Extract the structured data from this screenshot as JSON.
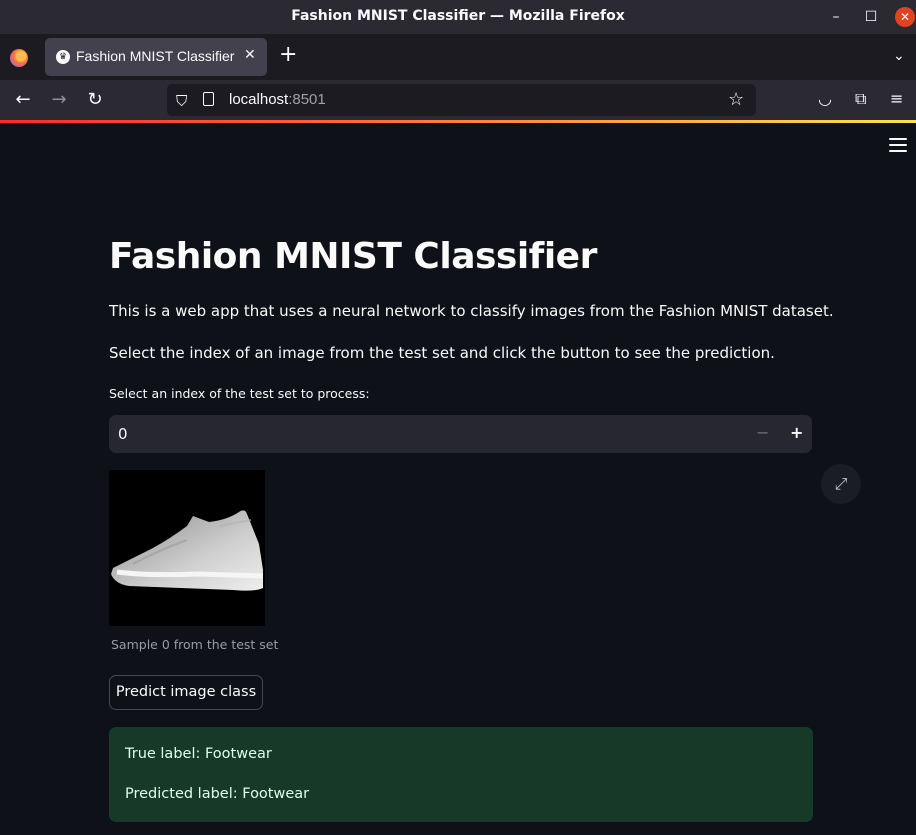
{
  "window": {
    "title": "Fashion MNIST Classifier — Mozilla Firefox"
  },
  "tabs": [
    {
      "label": "Fashion MNIST Classifier",
      "icon": "streamlit-crown-icon"
    }
  ],
  "navbar": {
    "url_host": "localhost",
    "url_port": ":8501"
  },
  "app": {
    "title": "Fashion MNIST Classifier",
    "intro": "This is a web app that uses a neural network to classify images from the Fashion MNIST dataset.",
    "instruction": "Select the index of an image from the test set and click the button to see the prediction.",
    "index_input": {
      "label": "Select an index of the test set to process:",
      "value": "0"
    },
    "image_caption": "Sample 0 from the test set",
    "predict_button": "Predict image class",
    "result": {
      "true_label": "True label: Footwear",
      "predicted_label": "Predicted label: Footwear",
      "color": "#173928"
    }
  },
  "colors": {
    "background": "#0e1117",
    "input_bg": "#262730",
    "accent_load": "#ff6a3a"
  }
}
